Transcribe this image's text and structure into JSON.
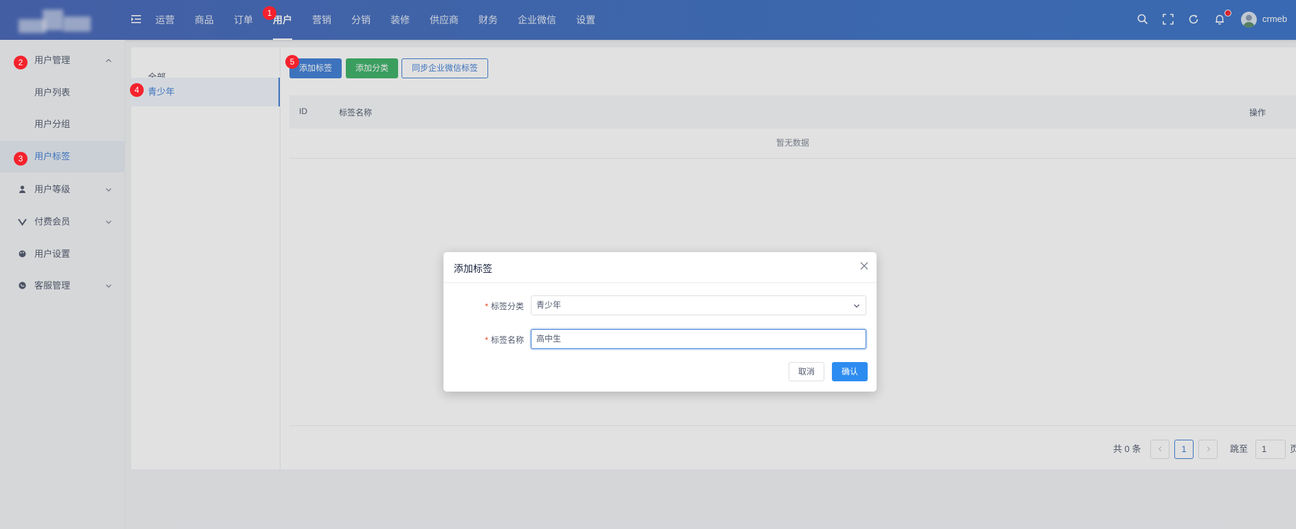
{
  "header": {
    "nav": [
      "运营",
      "商品",
      "订单",
      "用户",
      "营销",
      "分销",
      "装修",
      "供应商",
      "财务",
      "企业微信",
      "设置"
    ],
    "username": "crmeb"
  },
  "sidebar": {
    "groups": [
      {
        "label": "用户管理",
        "icon": "user-manage-icon",
        "expanded": true,
        "children": [
          "用户列表",
          "用户分组",
          "用户标签"
        ]
      },
      {
        "label": "用户等级",
        "icon": "user-icon"
      },
      {
        "label": "付费会员",
        "icon": "vip-icon"
      },
      {
        "label": "用户设置",
        "icon": "palette-icon"
      },
      {
        "label": "客服管理",
        "icon": "chat-icon"
      }
    ]
  },
  "tree": {
    "items": [
      "全部",
      "青少年"
    ]
  },
  "toolbar": {
    "add_tag": "添加标签",
    "add_category": "添加分类",
    "sync_wechat": "同步企业微信标签"
  },
  "table": {
    "columns": [
      "ID",
      "标签名称",
      "操作"
    ],
    "empty_text": "暂无数据"
  },
  "pagination": {
    "total": "共 0 条",
    "current": "1",
    "jump_label": "跳至",
    "jump_value": "1",
    "page_suffix": "页"
  },
  "markers": [
    "1",
    "2",
    "3",
    "4",
    "5"
  ],
  "modal": {
    "title": "添加标签",
    "required_mark": "*",
    "category_label": "标签分类",
    "category_value": "青少年",
    "name_label": "标签名称",
    "name_value": "高中生",
    "cancel": "取消",
    "confirm": "确认"
  },
  "colors": {
    "primary": "#3f7ed5",
    "success": "#3bb165",
    "header": "#4766b8",
    "marker": "#f5222d"
  }
}
